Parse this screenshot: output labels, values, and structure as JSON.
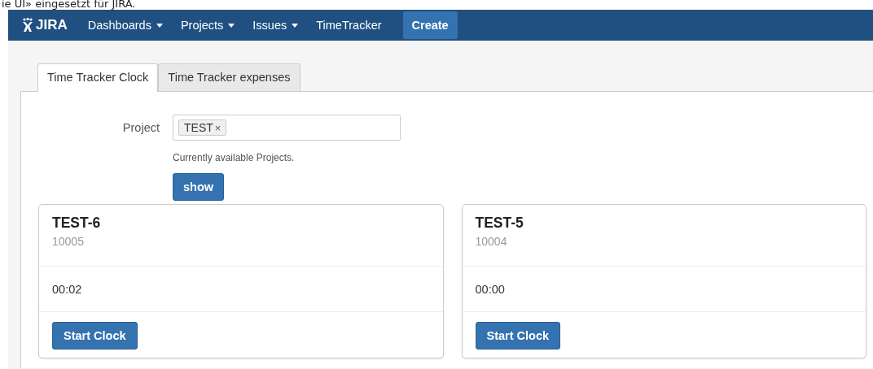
{
  "caption": "ie UI» eingesetzt für JIRA.",
  "navbar": {
    "logo": "JIRA",
    "menus": [
      {
        "label": "Dashboards",
        "dropdown": true
      },
      {
        "label": "Projects",
        "dropdown": true
      },
      {
        "label": "Issues",
        "dropdown": true
      },
      {
        "label": "TimeTracker",
        "dropdown": false
      }
    ],
    "create_button": "Create"
  },
  "tabs": [
    {
      "label": "Time Tracker Clock",
      "selected": true
    },
    {
      "label": "Time Tracker expenses",
      "selected": false
    }
  ],
  "form": {
    "label": "Project",
    "tokens": [
      "TEST"
    ],
    "remove": "×",
    "help": "Currently available Projects.",
    "button": "show"
  },
  "cards": [
    {
      "title": "TEST-6",
      "id": "10005",
      "time": "00:02",
      "button": "Start Clock"
    },
    {
      "title": "TEST-5",
      "id": "10004",
      "time": "00:00",
      "button": "Start Clock"
    }
  ]
}
